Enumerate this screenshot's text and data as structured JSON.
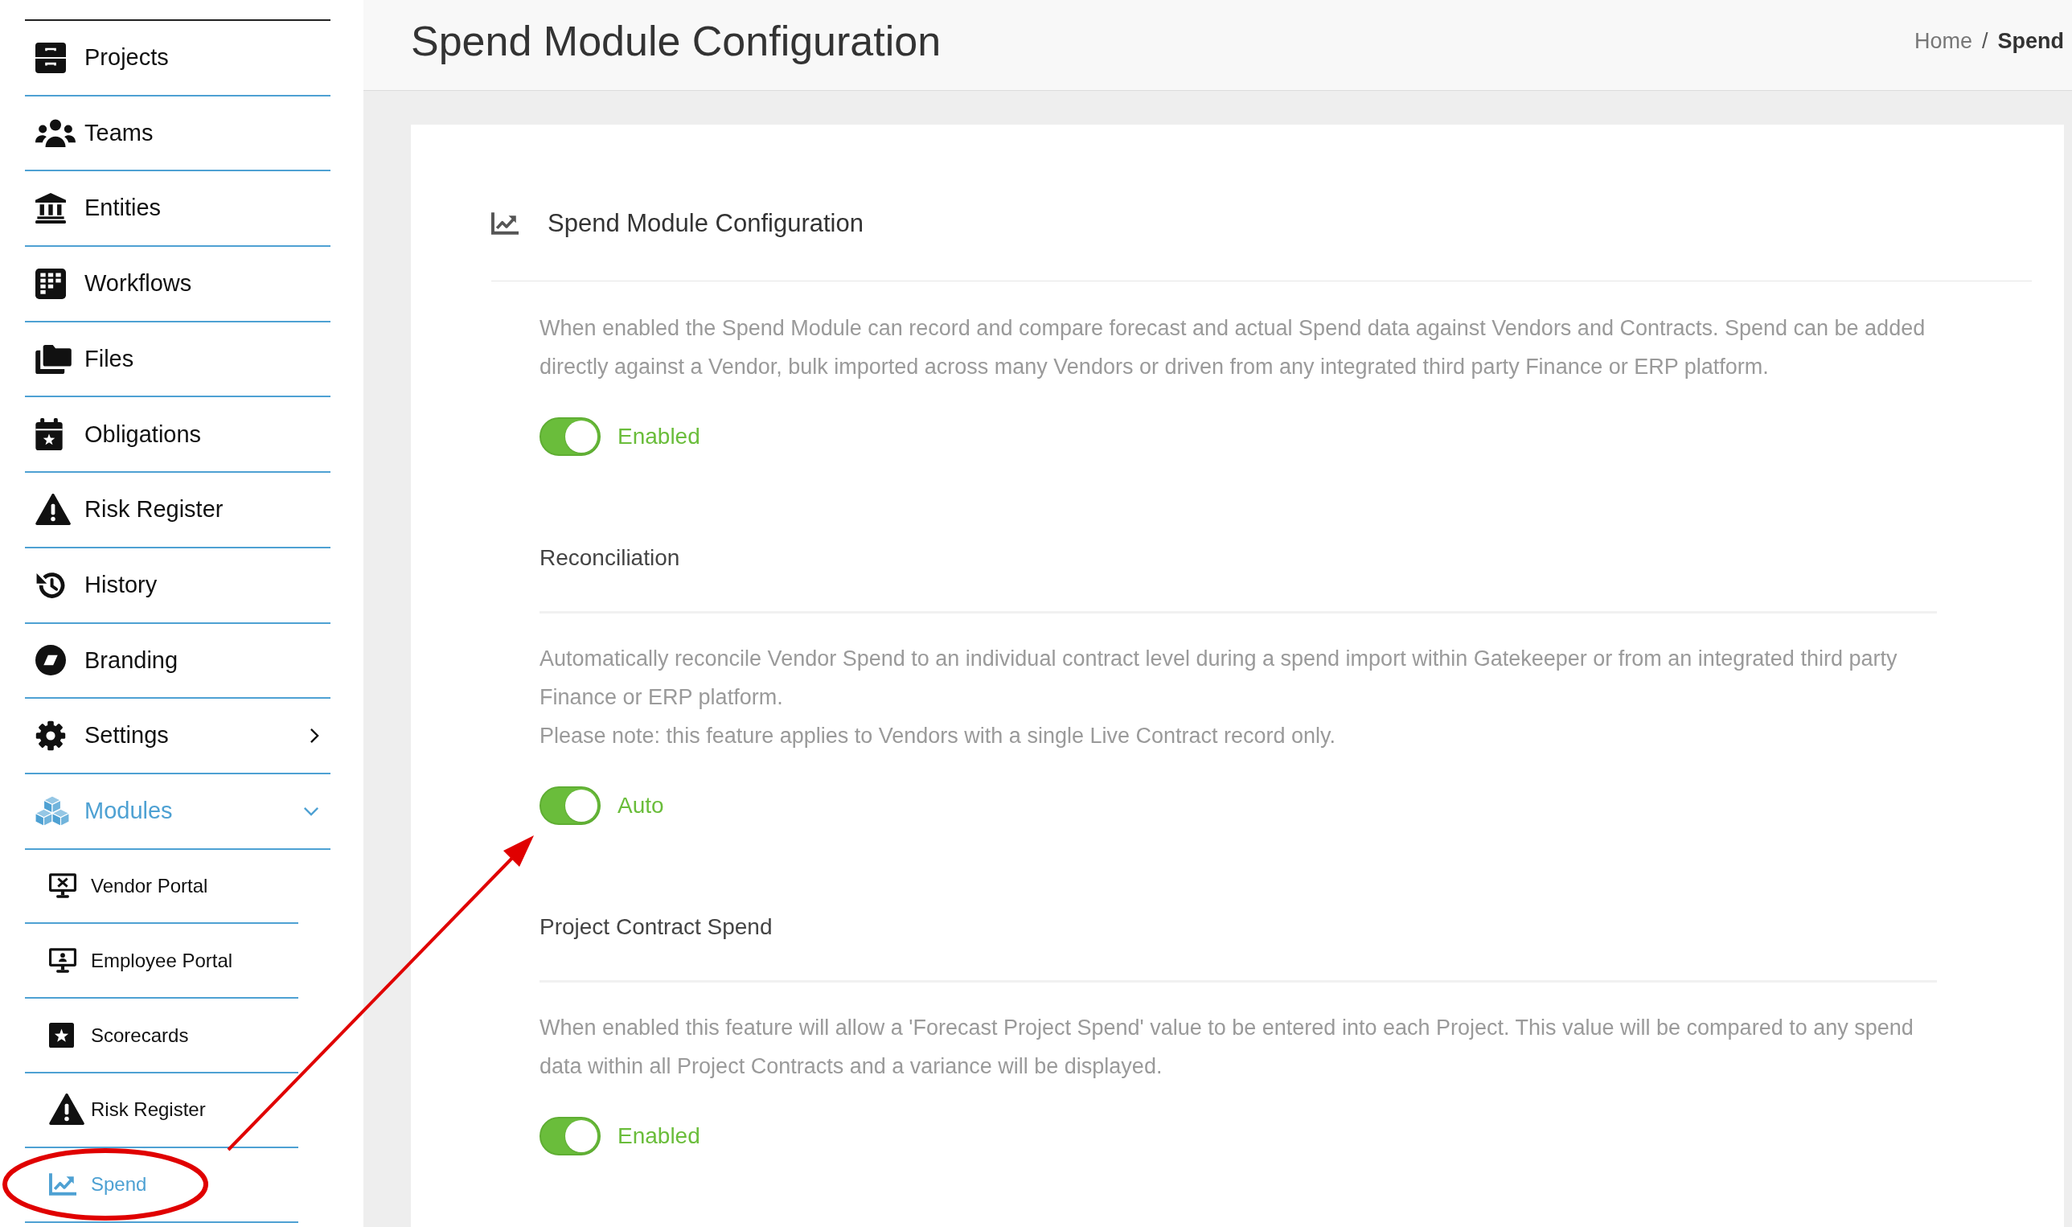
{
  "sidebar": {
    "items": [
      {
        "label": "Projects",
        "kind": "link",
        "selected": false
      },
      {
        "label": "Teams",
        "kind": "link",
        "selected": false
      },
      {
        "label": "Entities",
        "kind": "link",
        "selected": false
      },
      {
        "label": "Workflows",
        "kind": "link",
        "selected": false
      },
      {
        "label": "Files",
        "kind": "link",
        "selected": false
      },
      {
        "label": "Obligations",
        "kind": "link",
        "selected": false
      },
      {
        "label": "Risk Register",
        "kind": "link",
        "selected": false
      },
      {
        "label": "History",
        "kind": "link",
        "selected": false
      },
      {
        "label": "Branding",
        "kind": "link",
        "selected": false
      },
      {
        "label": "Settings",
        "kind": "group",
        "selected": false,
        "expanded": false
      },
      {
        "label": "Modules",
        "kind": "group",
        "selected": true,
        "expanded": true,
        "children": [
          {
            "label": "Vendor Portal",
            "selected": false
          },
          {
            "label": "Employee Portal",
            "selected": false
          },
          {
            "label": "Scorecards",
            "selected": false
          },
          {
            "label": "Risk Register",
            "selected": false
          },
          {
            "label": "Spend",
            "selected": true
          }
        ]
      }
    ]
  },
  "header": {
    "title": "Spend Module Configuration",
    "breadcrumb": [
      {
        "label": "Home",
        "selected": false
      },
      {
        "label": "Spend",
        "selected": true
      }
    ],
    "breadcrumb_separator": "/"
  },
  "card": {
    "title": "Spend Module Configuration",
    "description": "When enabled the Spend Module can record and compare forecast and actual Spend data against Vendors and Contracts. Spend can be added directly against a Vendor, bulk imported across many Vendors or driven from any integrated third party Finance or ERP platform.",
    "toggle": {
      "on": true,
      "label": "Enabled"
    },
    "sections": [
      {
        "heading": "Reconciliation",
        "paragraphs": [
          "Automatically reconcile Vendor Spend to an individual contract level during a spend import within Gatekeeper or from an integrated third party Finance or ERP platform.",
          "Please note: this feature applies to Vendors with a single Live Contract record only."
        ],
        "toggle": {
          "on": true,
          "label": "Auto"
        }
      },
      {
        "heading": "Project Contract Spend",
        "paragraphs": [
          "When enabled this feature will allow a 'Forecast Project Spend' value to be entered into each Project. This value will be compared to any spend data within all Project Contracts and a variance will be displayed."
        ],
        "toggle": {
          "on": true,
          "label": "Enabled"
        }
      }
    ]
  }
}
